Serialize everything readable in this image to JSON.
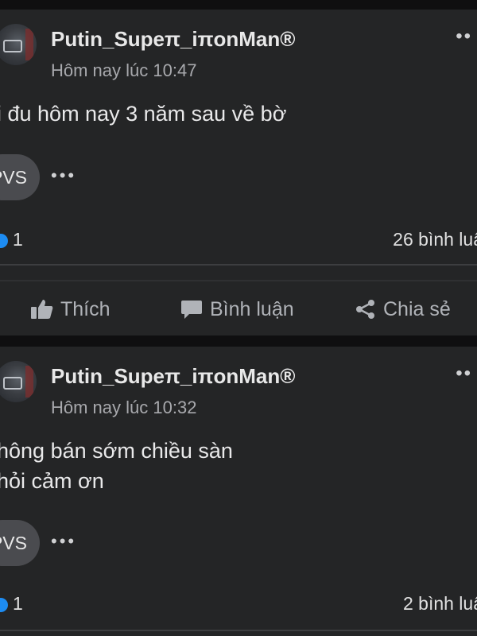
{
  "posts": [
    {
      "author": "Putin_Supeπ_iπonMan®",
      "time": "Hôm nay lúc 10:47",
      "content_lines": [
        "i đu hôm nay 3 năm sau về bờ"
      ],
      "chip": "PVS",
      "reactions_count": "1",
      "comments": "26 bình luậ",
      "actions": {
        "like": "Thích",
        "comment": "Bình luận",
        "share": "Chia sẻ"
      }
    },
    {
      "author": "Putin_Supeπ_iπonMan®",
      "time": "Hôm nay lúc 10:32",
      "content_lines": [
        "hông bán sớm chiều sàn",
        "hỏi cảm ơn"
      ],
      "chip": "PVS",
      "reactions_count": "1",
      "comments": "2 bình luậ"
    }
  ],
  "icons": {
    "more": "more-dots-icon",
    "like": "thumbs-up-icon",
    "comment": "speech-bubble-icon",
    "share": "share-icon"
  },
  "colors": {
    "background": "#0f0f10",
    "card": "#242526",
    "chip": "#4a4b4f",
    "muted_text": "#a8a9ad",
    "reaction_blue": "#1d8cf2"
  }
}
